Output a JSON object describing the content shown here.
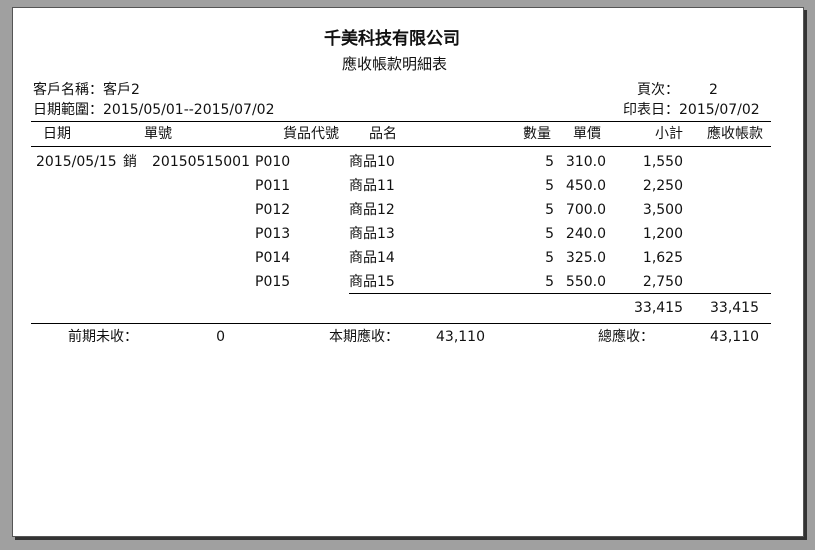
{
  "report": {
    "company": "千美科技有限公司",
    "title": "應收帳款明細表"
  },
  "info": {
    "customer": "客戶名稱：客戶2",
    "date_range": "日期範圍：2015/05/01--2015/07/02",
    "page_label": "頁次：",
    "page_value": "2",
    "print_date": "印表日：2015/07/02"
  },
  "columns": {
    "date": "日期",
    "doc_no": "單號",
    "item_code": "貨品代號",
    "item_name": "品名",
    "qty": "數量",
    "price": "單價",
    "subtotal": "小計",
    "receivable": "應收帳款"
  },
  "entry": {
    "date": "2015/05/15",
    "type": "銷",
    "doc_no": "20150515001"
  },
  "rows": [
    {
      "code": "P010",
      "name": "商品10",
      "qty": "5",
      "price": "310.0",
      "subtotal": "1,550"
    },
    {
      "code": "P011",
      "name": "商品11",
      "qty": "5",
      "price": "450.0",
      "subtotal": "2,250"
    },
    {
      "code": "P012",
      "name": "商品12",
      "qty": "5",
      "price": "700.0",
      "subtotal": "3,500"
    },
    {
      "code": "P013",
      "name": "商品13",
      "qty": "5",
      "price": "240.0",
      "subtotal": "1,200"
    },
    {
      "code": "P014",
      "name": "商品14",
      "qty": "5",
      "price": "325.0",
      "subtotal": "1,625"
    },
    {
      "code": "P015",
      "name": "商品15",
      "qty": "5",
      "price": "550.0",
      "subtotal": "2,750"
    }
  ],
  "totals": {
    "subtotal": "33,415",
    "receivable": "33,415"
  },
  "summary": {
    "prev_label": "前期未收：",
    "prev_value": "0",
    "current_label": "本期應收：",
    "current_value": "43,110",
    "total_label": "總應收：",
    "total_value": "43,110"
  }
}
